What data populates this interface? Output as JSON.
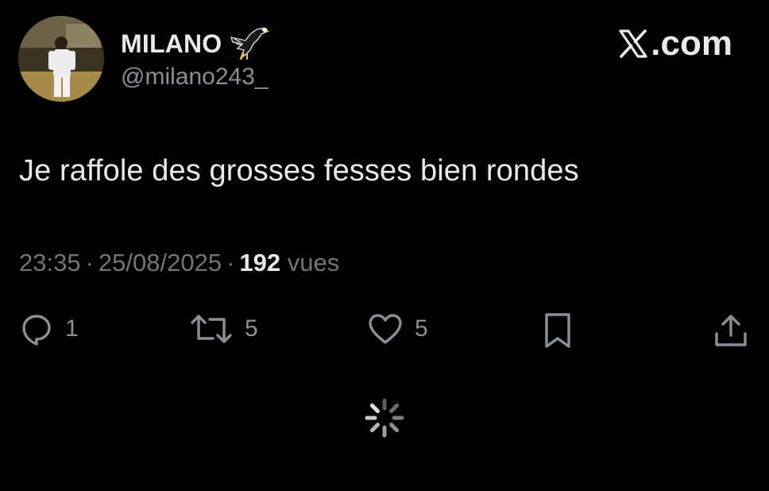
{
  "author": {
    "display_name": "MILANO",
    "handle": "@milano243_",
    "avatar_alt": "profile photo",
    "badge_icon": "eagle-emoji"
  },
  "brand": {
    "label": ".com",
    "icon": "x-logo"
  },
  "tweet": {
    "text": "Je raffole des grosses fesses bien rondes",
    "time": "23:35",
    "date": "25/08/2025",
    "separator": "·",
    "views_count": "192",
    "views_label": "vues"
  },
  "actions": {
    "reply_count": "1",
    "retweet_count": "5",
    "like_count": "5"
  },
  "colors": {
    "background": "#000000",
    "primary_text": "#e7e9ea",
    "secondary_text": "#71767b",
    "icon": "#8b9096"
  }
}
